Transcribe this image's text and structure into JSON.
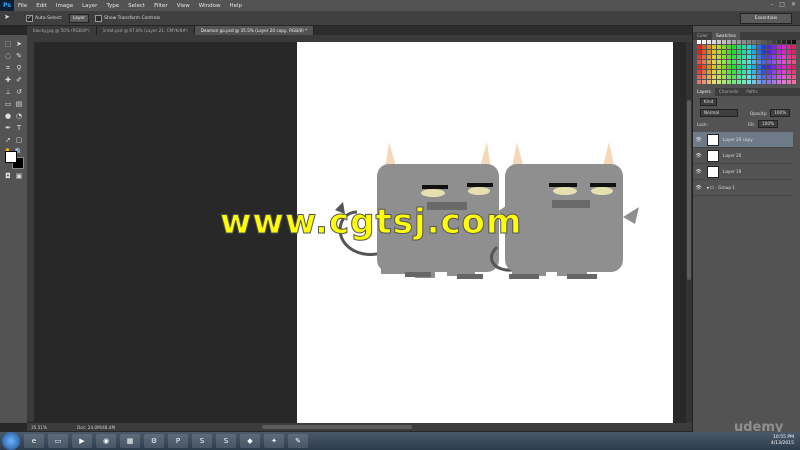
{
  "app": {
    "logo": "Ps"
  },
  "menubar": {
    "items": [
      "File",
      "Edit",
      "Image",
      "Layer",
      "Type",
      "Select",
      "Filter",
      "View",
      "Window",
      "Help"
    ]
  },
  "options_bar": {
    "auto_select_label": "Auto-Select:",
    "auto_select_value": "Layer",
    "show_transform_label": "Show Transform Controls",
    "workspace": "Essentials"
  },
  "tabs": [
    {
      "label": "blocky.jpg @ 50% (RGB/8*)",
      "active": false
    },
    {
      "label": "1mbt.psd @ 67.8% (Layer 21, CMYK/8#)",
      "active": false
    },
    {
      "label": "Deamon go.psd @ 35.5% (Layer 20 copy, RGB/8) *",
      "active": true
    }
  ],
  "status": {
    "zoom": "35.51%",
    "doc_size": "Doc: 24.0M/48.4M"
  },
  "panels": {
    "color_tabs": [
      "Color",
      "Swatches"
    ],
    "layer_tabs": [
      "Layers",
      "Channels",
      "Paths"
    ],
    "kind_label": "Kind",
    "blend_mode": "Normal",
    "opacity_label": "Opacity:",
    "opacity_value": "100%",
    "lock_label": "Lock:",
    "fill_label": "Fill:",
    "fill_value": "100%",
    "layers": [
      {
        "name": "Layer 20 copy",
        "selected": true
      },
      {
        "name": "Layer 20",
        "selected": false
      },
      {
        "name": "Layer 19",
        "selected": false
      },
      {
        "name": "Group 1",
        "selected": false
      }
    ]
  },
  "colors": {
    "foreground": "#ffffff",
    "background": "#000000",
    "monster_body": "#8f8f8f",
    "horn": "#f6d8b8",
    "selected_layer": "#6e7a88"
  },
  "watermark": "www.cgtsj.com",
  "taskbar": {
    "time": "10:55 PM",
    "date": "4/13/2015",
    "icons": [
      "ie-icon",
      "folder-icon",
      "media-icon",
      "chrome-icon",
      "calculator-icon",
      "network-icon",
      "photoshop-icon",
      "skype-icon",
      "app-s-icon",
      "app-blue-icon",
      "app-dark-icon",
      "app-paint-icon"
    ]
  },
  "overlay_brand": "udemy"
}
